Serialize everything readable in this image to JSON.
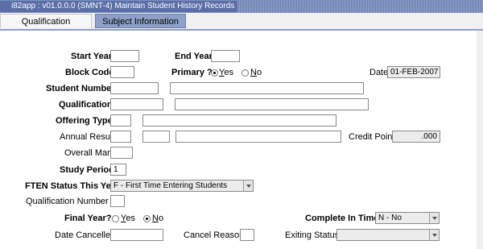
{
  "window": {
    "title": "i82app : v01.0.0.0 (SMNT-4) Maintain Student History Records"
  },
  "tabs": [
    {
      "label": "Qualification Information"
    },
    {
      "label": "Subject Information"
    }
  ],
  "form": {
    "start_year_label": "Start Year",
    "end_year_label": "End Year",
    "block_code_label": "Block Code",
    "primary_label": "Primary ?",
    "primary_yes": "Yes",
    "primary_no": "No",
    "primary_selected": "Yes",
    "date_label": "Date",
    "date_value": "01-FEB-2007",
    "student_number_label": "Student Number",
    "qualification_label": "Qualification",
    "offering_type_label": "Offering Type",
    "annual_result_label": "Annual Result",
    "credit_point_label": "Credit Point",
    "credit_point_value": ".000",
    "overall_mark_label": "Overall Mark",
    "study_period_label": "Study Period",
    "study_period_value": "1",
    "ften_label": "FTEN Status This Year",
    "ften_value": "F - First Time Entering Students",
    "qualification_number_label": "Qualification Number",
    "final_year_label": "Final Year?",
    "final_year_yes": "Yes",
    "final_year_no": "No",
    "final_year_selected": "No",
    "complete_in_time_label": "Complete In Time",
    "complete_in_time_value": "N - No",
    "date_cancelled_label": "Date Cancelled",
    "cancel_reason_label": "Cancel Reason",
    "exiting_status_label": "Exiting Status",
    "exiting_status_value": ""
  }
}
